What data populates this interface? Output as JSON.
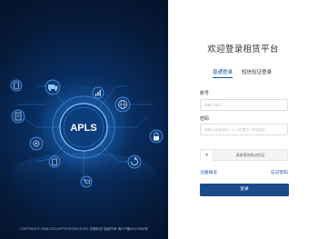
{
  "hero": {
    "logo_text": "APLS",
    "copyright": "COPYRIGHT 2006-2023 APPOTRONICS INC 光峰科技 版权所有 粤ICP备08117660号"
  },
  "login": {
    "title": "欢迎登录租赁平台",
    "tabs": [
      {
        "label": "普通登录",
        "active": true
      },
      {
        "label": "短信验证登录",
        "active": false
      }
    ],
    "account_label": "账号",
    "account_placeholder": "请输入账号",
    "password_label": "密码",
    "password_placeholder": "请输入登录密码，6-12位数字+字母组合",
    "slider_text": "请按滑块拖动验证",
    "slider_icon": "double-chevron-right-icon",
    "register_label": "注册账号",
    "forgot_label": "忘记密码",
    "submit_label": "登录"
  },
  "colors": {
    "accent": "#1a56a6",
    "button": "#1c4b8a",
    "hero_bg": "#061a3a",
    "hero_glow": "#2f7fd6"
  }
}
